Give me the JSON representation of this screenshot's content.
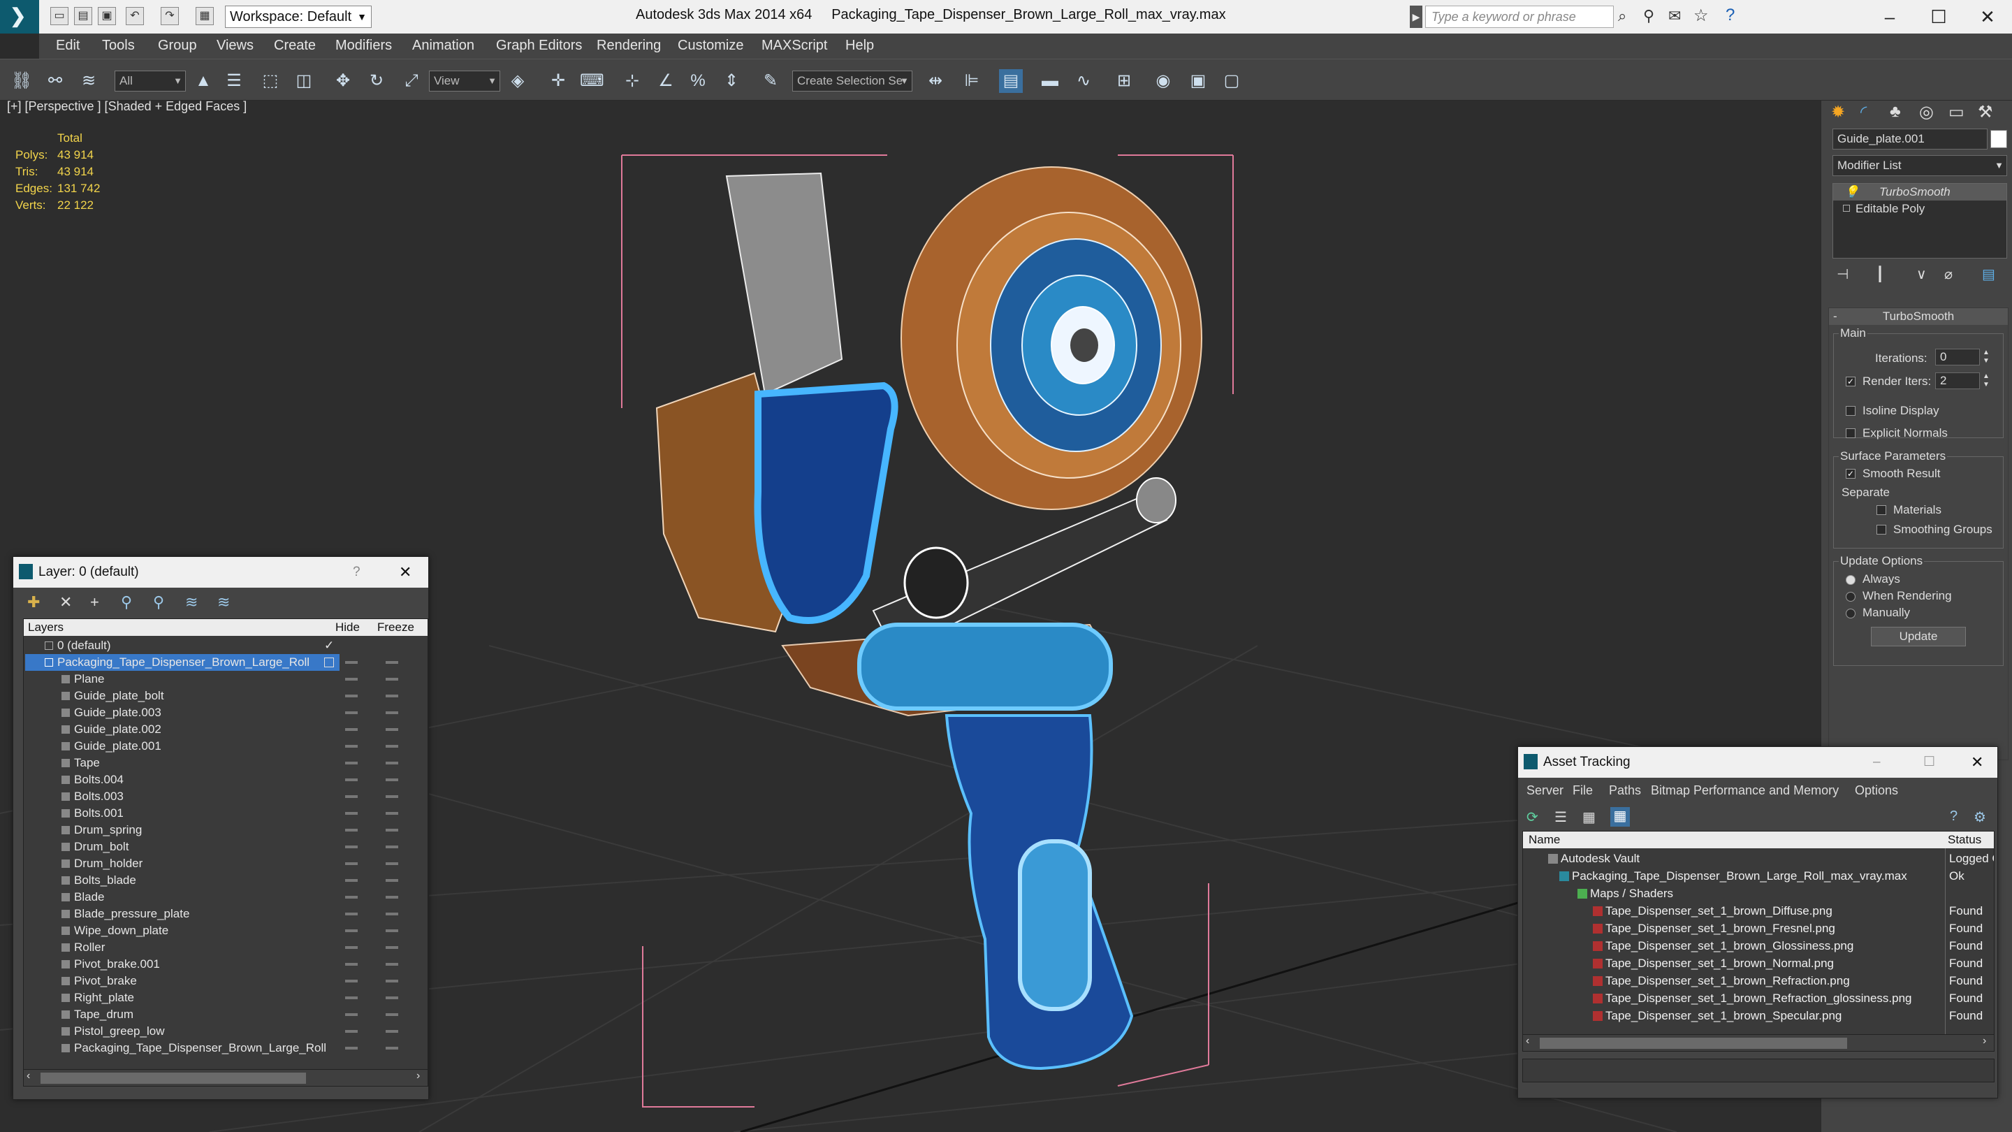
{
  "window": {
    "app_title": "Autodesk 3ds Max  2014 x64",
    "file_title": "Packaging_Tape_Dispenser_Brown_Large_Roll_max_vray.max"
  },
  "quickaccess": {
    "workspace": "Workspace: Default",
    "search_placeholder": "Type a keyword or phrase"
  },
  "menu": [
    "Edit",
    "Tools",
    "Group",
    "Views",
    "Create",
    "Modifiers",
    "Animation",
    "Graph Editors",
    "Rendering",
    "Customize",
    "MAXScript",
    "Help"
  ],
  "toolbar": {
    "filter": "All",
    "ref_coord": "View",
    "selection_set": "Create Selection Se"
  },
  "viewport": {
    "label": "[+] [Perspective ] [Shaded + Edged Faces ]",
    "stats": {
      "header": "Total",
      "rows": [
        {
          "k": "Polys:",
          "v": "43 914"
        },
        {
          "k": "Tris:",
          "v": "43 914"
        },
        {
          "k": "Edges:",
          "v": "131 742"
        },
        {
          "k": "Verts:",
          "v": "22 122"
        }
      ]
    }
  },
  "command_panel": {
    "object_name": "Guide_plate.001",
    "modifier_list": "Modifier List",
    "stack": [
      "TurboSmooth",
      "Editable Poly"
    ],
    "rollout": "TurboSmooth",
    "main": "Main",
    "iterations_label": "Iterations:",
    "iterations": "0",
    "render_iters_label": "Render Iters:",
    "render_iters": "2",
    "isoline": "Isoline Display",
    "explicit": "Explicit Normals",
    "surface": "Surface Parameters",
    "smooth_result": "Smooth Result",
    "separate": "Separate",
    "materials": "Materials",
    "smoothing_groups": "Smoothing Groups",
    "update_options": "Update Options",
    "always": "Always",
    "when_rendering": "When Rendering",
    "manually": "Manually",
    "update": "Update"
  },
  "layer_dialog": {
    "title": "Layer: 0 (default)",
    "help": "?",
    "col_layers": "Layers",
    "col_hide": "Hide",
    "col_freeze": "Freeze",
    "default_layer": "0 (default)",
    "selected_layer": "Packaging_Tape_Dispenser_Brown_Large_Roll",
    "objects": [
      "Plane",
      "Guide_plate_bolt",
      "Guide_plate.003",
      "Guide_plate.002",
      "Guide_plate.001",
      "Tape",
      "Bolts.004",
      "Bolts.003",
      "Bolts.001",
      "Drum_spring",
      "Drum_bolt",
      "Drum_holder",
      "Bolts_blade",
      "Blade",
      "Blade_pressure_plate",
      "Wipe_down_plate",
      "Roller",
      "Pivot_brake.001",
      "Pivot_brake",
      "Right_plate",
      "Tape_drum",
      "Pistol_greep_low",
      "Packaging_Tape_Dispenser_Brown_Large_Roll"
    ]
  },
  "asset_tracking": {
    "title": "Asset Tracking",
    "menu": [
      "Server",
      "File",
      "Paths",
      "Bitmap Performance and Memory",
      "Options"
    ],
    "col_name": "Name",
    "col_status": "Status",
    "vault": "Autodesk Vault",
    "vault_status": "Logged O",
    "file": "Packaging_Tape_Dispenser_Brown_Large_Roll_max_vray.max",
    "file_status": "Ok",
    "maps": "Maps / Shaders",
    "maps_list": [
      {
        "n": "Tape_Dispenser_set_1_brown_Diffuse.png",
        "s": "Found"
      },
      {
        "n": "Tape_Dispenser_set_1_brown_Fresnel.png",
        "s": "Found"
      },
      {
        "n": "Tape_Dispenser_set_1_brown_Glossiness.png",
        "s": "Found"
      },
      {
        "n": "Tape_Dispenser_set_1_brown_Normal.png",
        "s": "Found"
      },
      {
        "n": "Tape_Dispenser_set_1_brown_Refraction.png",
        "s": "Found"
      },
      {
        "n": "Tape_Dispenser_set_1_brown_Refraction_glossiness.png",
        "s": "Found"
      },
      {
        "n": "Tape_Dispenser_set_1_brown_Specular.png",
        "s": "Found"
      }
    ]
  }
}
